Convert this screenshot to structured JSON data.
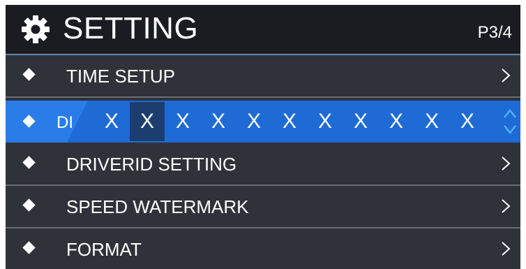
{
  "header": {
    "title": "SETTING",
    "page_indicator": "P3/4",
    "icon": "gear-icon"
  },
  "menu": {
    "items": [
      {
        "label": "TIME SETUP",
        "icon": "chevron-right-icon"
      },
      {
        "label": "DRIVERID SETTING",
        "icon": "chevron-right-icon"
      },
      {
        "label": "SPEED WATERMARK",
        "icon": "chevron-right-icon"
      },
      {
        "label": "FORMAT",
        "icon": "chevron-right-icon"
      }
    ]
  },
  "editor": {
    "label_partial": "DI",
    "characters": [
      "X",
      "X",
      "X",
      "X",
      "X",
      "X",
      "X",
      "X",
      "X",
      "X",
      "X"
    ],
    "active_index": 1,
    "control_icon": "up-down-arrows-icon"
  },
  "colors": {
    "header_bg": "#1b1c21",
    "row_bg": "#2f3239",
    "selected_bg": "#1f6bd6",
    "active_cell_bg": "#1c3e6e",
    "divider": "#6a6d74",
    "header_border": "#5f86ad",
    "text": "#ffffff"
  }
}
